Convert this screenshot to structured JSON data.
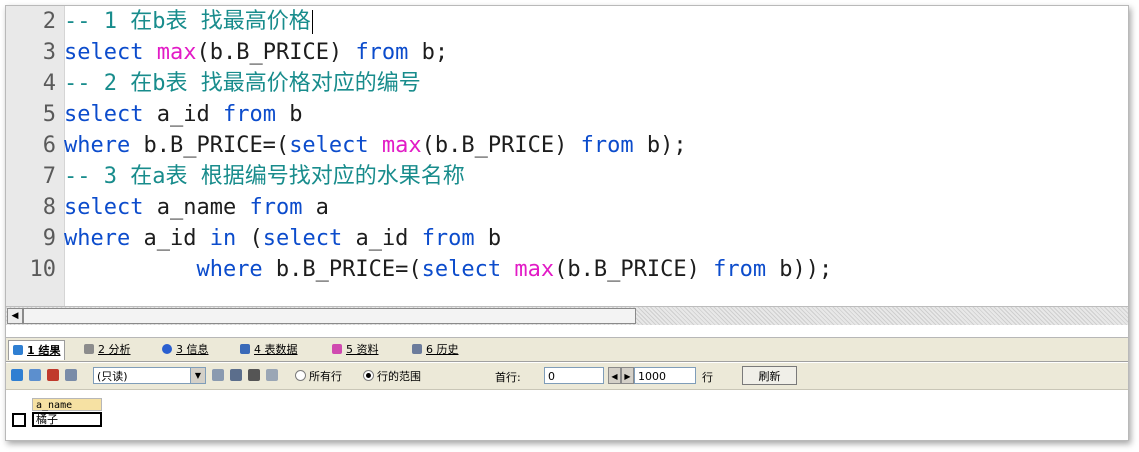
{
  "editor": {
    "lines": [
      {
        "num": "2",
        "segments": [
          {
            "t": "cm",
            "text": "-- 1 在b表 找最高价格"
          }
        ]
      },
      {
        "num": "3",
        "segments": [
          {
            "t": "kw",
            "text": "select"
          },
          {
            "t": "id",
            "text": " "
          },
          {
            "t": "fn",
            "text": "max"
          },
          {
            "t": "id",
            "text": "(b.B_PRICE) "
          },
          {
            "t": "kw",
            "text": "from"
          },
          {
            "t": "id",
            "text": " b;"
          }
        ]
      },
      {
        "num": "4",
        "segments": [
          {
            "t": "cm",
            "text": "-- 2 在b表 找最高价格对应的编号"
          }
        ]
      },
      {
        "num": "5",
        "segments": [
          {
            "t": "kw",
            "text": "select"
          },
          {
            "t": "id",
            "text": " a_id "
          },
          {
            "t": "kw",
            "text": "from"
          },
          {
            "t": "id",
            "text": " b"
          }
        ]
      },
      {
        "num": "6",
        "segments": [
          {
            "t": "kw",
            "text": "where"
          },
          {
            "t": "id",
            "text": " b.B_PRICE=("
          },
          {
            "t": "kw",
            "text": "select"
          },
          {
            "t": "id",
            "text": " "
          },
          {
            "t": "fn",
            "text": "max"
          },
          {
            "t": "id",
            "text": "(b.B_PRICE) "
          },
          {
            "t": "kw",
            "text": "from"
          },
          {
            "t": "id",
            "text": " b);"
          }
        ]
      },
      {
        "num": "7",
        "segments": [
          {
            "t": "cm",
            "text": "-- 3 在a表 根据编号找对应的水果名称"
          }
        ]
      },
      {
        "num": "8",
        "segments": [
          {
            "t": "kw",
            "text": "select"
          },
          {
            "t": "id",
            "text": " a_name "
          },
          {
            "t": "kw",
            "text": "from"
          },
          {
            "t": "id",
            "text": " a"
          }
        ]
      },
      {
        "num": "9",
        "segments": [
          {
            "t": "kw",
            "text": "where"
          },
          {
            "t": "id",
            "text": " a_id "
          },
          {
            "t": "kw",
            "text": "in"
          },
          {
            "t": "id",
            "text": " ("
          },
          {
            "t": "kw",
            "text": "select"
          },
          {
            "t": "id",
            "text": " a_id "
          },
          {
            "t": "kw",
            "text": "from"
          },
          {
            "t": "id",
            "text": " b"
          }
        ]
      },
      {
        "num": "10",
        "segments": [
          {
            "t": "id",
            "text": "          "
          },
          {
            "t": "kw",
            "text": "where"
          },
          {
            "t": "id",
            "text": " b.B_PRICE=("
          },
          {
            "t": "kw",
            "text": "select"
          },
          {
            "t": "id",
            "text": " "
          },
          {
            "t": "fn",
            "text": "max"
          },
          {
            "t": "id",
            "text": "(b.B_PRICE) "
          },
          {
            "t": "kw",
            "text": "from"
          },
          {
            "t": "id",
            "text": " b));"
          }
        ]
      }
    ]
  },
  "tabs": [
    {
      "label": "1 结果",
      "active": true
    },
    {
      "label": "2 分析",
      "active": false
    },
    {
      "label": "3 信息",
      "active": false
    },
    {
      "label": "4 表数据",
      "active": false
    },
    {
      "label": "5 资料",
      "active": false
    },
    {
      "label": "6 历史",
      "active": false
    }
  ],
  "toolbar": {
    "mode_select": "(只读)",
    "radio_all_rows": "所有行",
    "radio_row_range": "行的范围",
    "first_row_label": "首行:",
    "first_row_value": "0",
    "row_count_value": "1000",
    "rows_label": "行",
    "refresh_label": "刷新"
  },
  "result_grid": {
    "columns": [
      "a_name"
    ],
    "rows": [
      [
        "橘子"
      ]
    ]
  },
  "colors": {
    "keyword": "#0c4ccc",
    "function": "#e21bc6",
    "comment": "#188c8c",
    "identifier": "#1d1d1d"
  }
}
